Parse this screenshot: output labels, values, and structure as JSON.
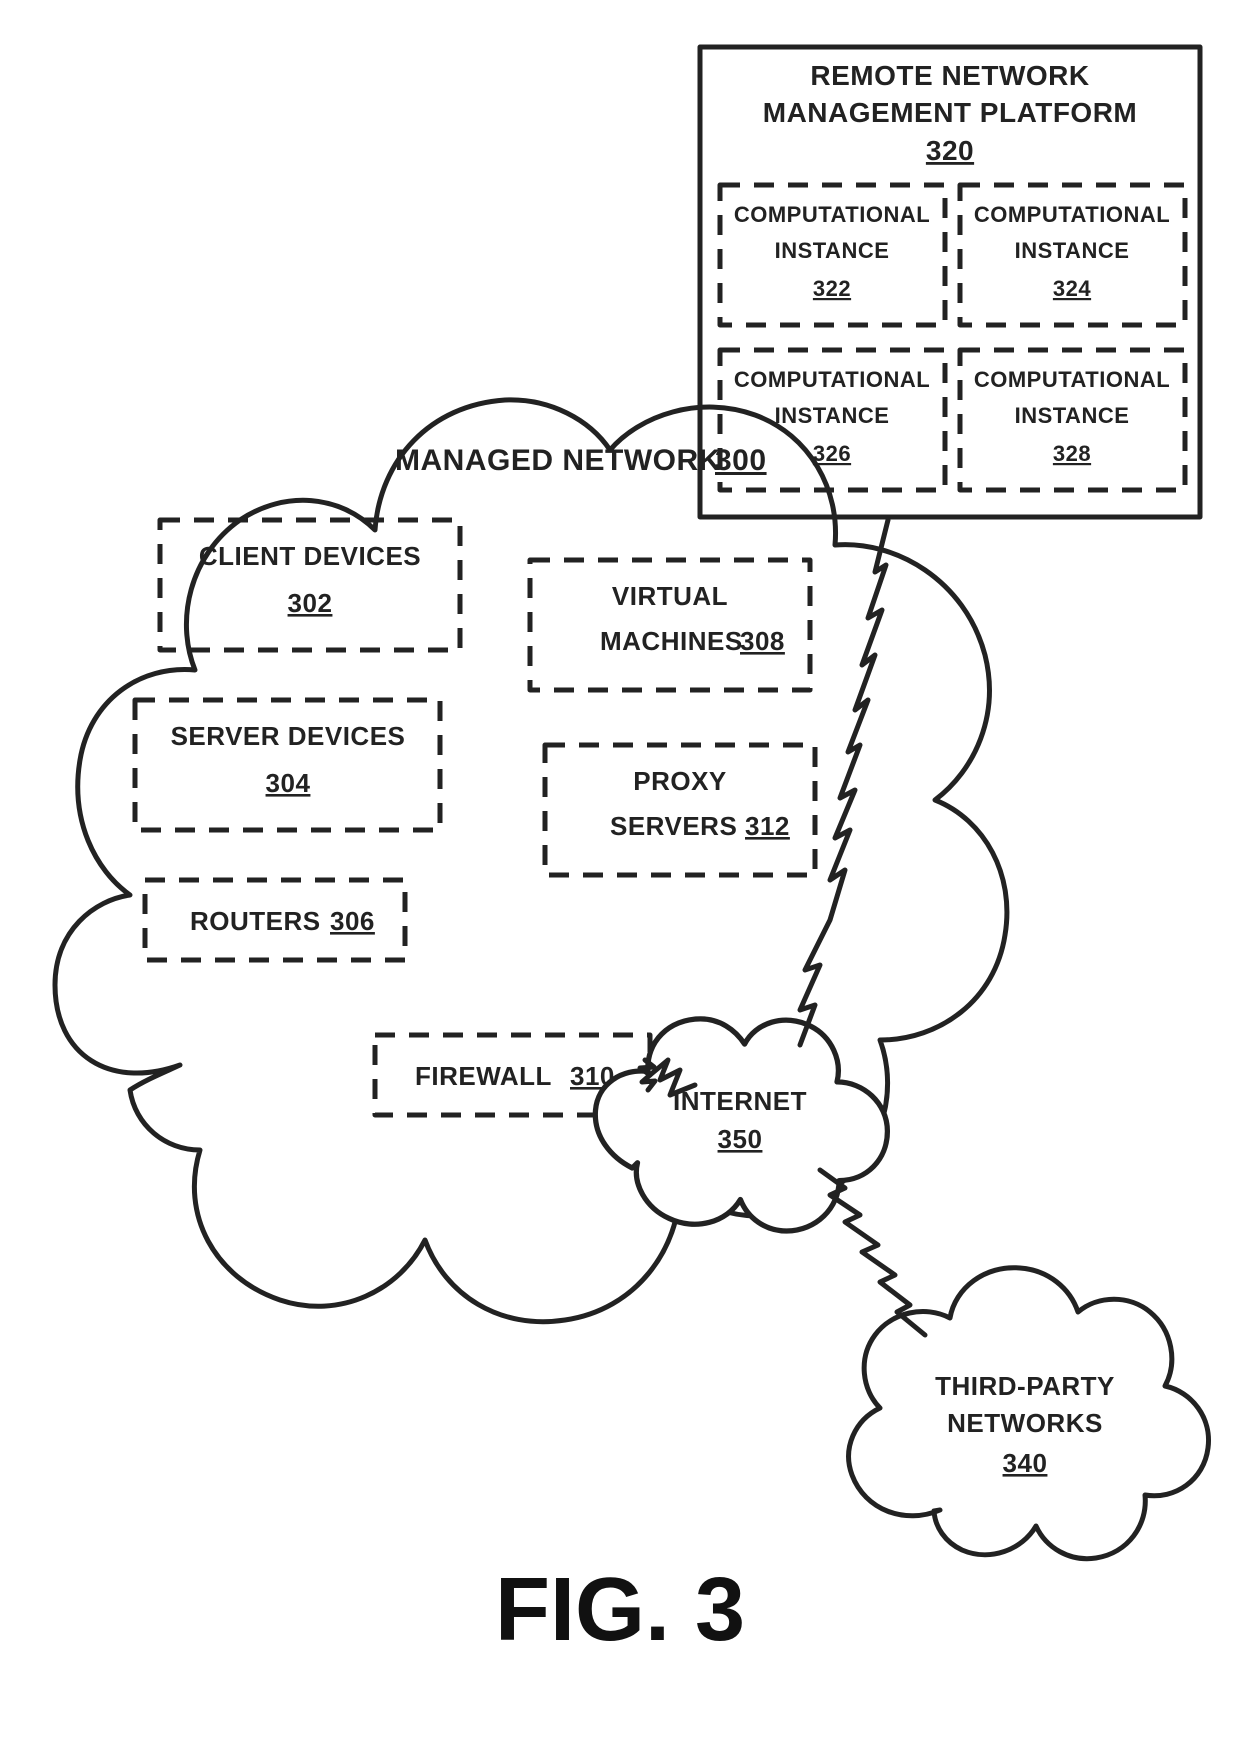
{
  "figure_label": "FIG. 3",
  "managed_network": {
    "title": "MANAGED NETWORK",
    "ref": "300",
    "client_devices": {
      "label": "CLIENT DEVICES",
      "ref": "302"
    },
    "server_devices": {
      "label": "SERVER DEVICES",
      "ref": "304"
    },
    "routers": {
      "label": "ROUTERS",
      "ref": "306"
    },
    "virtual_machines": {
      "label1": "VIRTUAL",
      "label2": "MACHINES",
      "ref": "308"
    },
    "proxy_servers": {
      "label1": "PROXY",
      "label2": "SERVERS",
      "ref": "312"
    },
    "firewall": {
      "label": "FIREWALL",
      "ref": "310"
    }
  },
  "rnmp": {
    "title1": "REMOTE NETWORK",
    "title2": "MANAGEMENT PLATFORM",
    "ref": "320",
    "inst322": {
      "label1": "COMPUTATIONAL",
      "label2": "INSTANCE",
      "ref": "322"
    },
    "inst324": {
      "label1": "COMPUTATIONAL",
      "label2": "INSTANCE",
      "ref": "324"
    },
    "inst326": {
      "label1": "COMPUTATIONAL",
      "label2": "INSTANCE",
      "ref": "326"
    },
    "inst328": {
      "label1": "COMPUTATIONAL",
      "label2": "INSTANCE",
      "ref": "328"
    }
  },
  "third_party": {
    "label1": "THIRD-PARTY",
    "label2": "NETWORKS",
    "ref": "340"
  },
  "internet": {
    "label": "INTERNET",
    "ref": "350"
  }
}
